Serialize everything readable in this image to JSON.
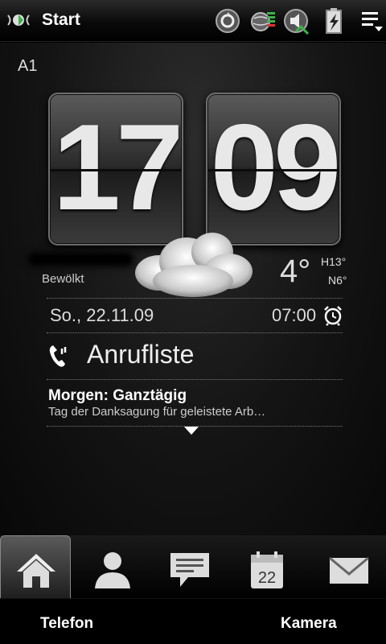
{
  "topbar": {
    "title": "Start",
    "icons": [
      "windows-start-icon",
      "sync-icon",
      "signal-icon",
      "volume-icon",
      "battery-icon",
      "menu-icon"
    ]
  },
  "carrier": "A1",
  "clock": {
    "hour": "17",
    "minute": "09"
  },
  "weather": {
    "condition": "Bewölkt",
    "temp": "4°",
    "high": "H13°",
    "low": "N6°",
    "icon": "cloud-icon"
  },
  "date": "So., 22.11.09",
  "alarm": {
    "time": "07:00",
    "icon": "alarm-clock-icon"
  },
  "calllog": {
    "label": "Anrufliste",
    "icon": "phone-icon"
  },
  "event": {
    "title": "Morgen: Ganztägig",
    "subtitle": "Tag der Danksagung für geleistete Arb…"
  },
  "dock": {
    "items": [
      "home-icon",
      "contacts-icon",
      "messages-icon",
      "calendar-icon",
      "mail-icon"
    ],
    "calendar_day": "22"
  },
  "softkeys": {
    "left": "Telefon",
    "right": "Kamera"
  },
  "colors": {
    "background": "#000000",
    "text": "#ffffff",
    "accent_green": "#3bb34a"
  }
}
